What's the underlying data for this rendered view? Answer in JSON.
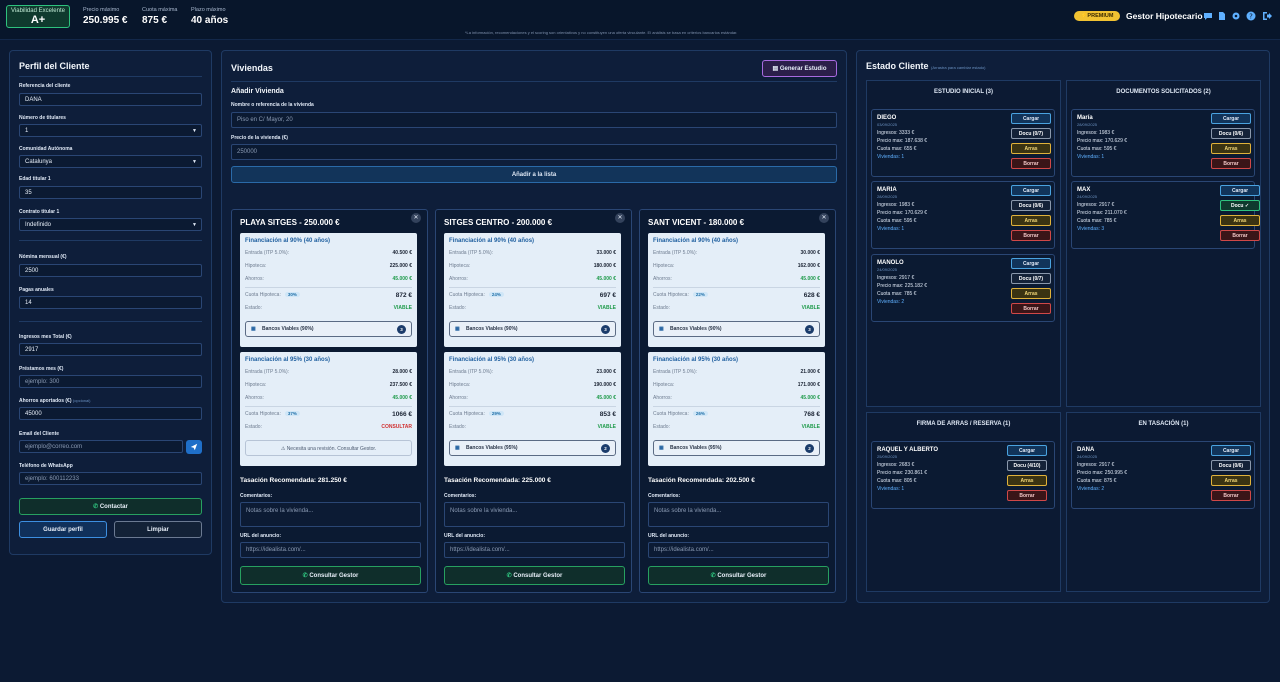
{
  "topbar": {
    "viability_title": "Viabilidad Excelente",
    "viability_grade": "A+",
    "stats": [
      {
        "label": "Precio máximo",
        "value": "250.995 €"
      },
      {
        "label": "Cuota máxima",
        "value": "875 €"
      },
      {
        "label": "Plazo máximo",
        "value": "40 años"
      }
    ],
    "premium": "⚡PREMIUM",
    "title": "Gestor Hipotecario",
    "icons": [
      "chat-icon",
      "document-icon",
      "gear-icon",
      "help-icon",
      "logout-icon"
    ],
    "disclaimer": "*La información, recomendaciones y el scoring son orientativos y no constituyen una oferta vinculante. El análisis se basa en criterios bancarios estándar."
  },
  "perfil": {
    "title": "Perfil del Cliente",
    "ref_label": "Referencia del cliente",
    "ref_value": "DANA",
    "titulares_label": "Número de titulares",
    "titulares_value": "1",
    "comunidad_label": "Comunidad Autónoma",
    "comunidad_value": "Catalunya",
    "edad_label": "Edad titular 1",
    "edad_value": "35",
    "contrato_label": "Contrato titular 1",
    "contrato_value": "Indefinido",
    "nomina_label": "Nómina mensual (€)",
    "nomina_value": "2500",
    "pagas_label": "Pagas anuales",
    "pagas_value": "14",
    "ingresos_label": "Ingresos mes Total (€)",
    "ingresos_value": "2917",
    "prestamos_label": "Préstamos mes (€)",
    "prestamos_placeholder": "ejemplo: 300",
    "ahorros_label": "Ahorros aportados (€)",
    "ahorros_opt": "(opcional)",
    "ahorros_value": "45000",
    "email_label": "Email del Cliente",
    "email_placeholder": "ejemplo@correo.com",
    "whatsapp_label": "Teléfono de WhatsApp",
    "whatsapp_placeholder": "ejemplo: 600112233",
    "contactar": "Contactar",
    "guardar": "Guardar perfil",
    "limpiar": "Limpiar"
  },
  "viviendas": {
    "title": "Viviendas",
    "generar": "Generar Estudio",
    "add_title": "Añadir Vivienda",
    "name_label": "Nombre o referencia de la vivienda",
    "name_placeholder": "Piso en C/ Mayor, 20",
    "price_label": "Precio de la vivienda (€)",
    "price_placeholder": "250000",
    "add_button": "Añadir a la lista",
    "cards": [
      {
        "title": "PLAYA SITGES - 250.000 €",
        "f1": {
          "h": "Financiación al 90% (40 años)",
          "itp": "Entrada (ITP 5.0%):",
          "itpv": "40.500 €",
          "hip": "Hipoteca:",
          "hipv": "225.000 €",
          "aho": "Ahorros:",
          "ahov": "45.000 €",
          "cuota": "Cuota Hipoteca:",
          "pct": "30%",
          "cuotav": "872 €",
          "est": "Estado:",
          "estv": "VIABLE",
          "bank": "Bancos Viables (90%)",
          "n": "3"
        },
        "f2": {
          "h": "Financiación al 95% (30 años)",
          "itp": "Entrada (ITP 5.0%):",
          "itpv": "28.000 €",
          "hip": "Hipoteca:",
          "hipv": "237.500 €",
          "aho": "Ahorros:",
          "ahov": "45.000 €",
          "cuota": "Cuota Hipoteca:",
          "pct": "37%",
          "cuotav": "1066 €",
          "est": "Estado:",
          "estv": "CONSULTAR",
          "revision": "Necesita una revisión. Consultar Gestor."
        },
        "tas_label": "Tasación Recomendada:",
        "tas_value": "281.250 €",
        "com_label": "Comentarios:",
        "com_ph": "Notas sobre la vivienda...",
        "url_label": "URL del anuncio:",
        "url_ph": "https://idealista.com/...",
        "consult": "Consultar Gestor"
      },
      {
        "title": "SITGES CENTRO - 200.000 €",
        "f1": {
          "h": "Financiación al 90% (40 años)",
          "itp": "Entrada (ITP 5.0%):",
          "itpv": "33.000 €",
          "hip": "Hipoteca:",
          "hipv": "180.000 €",
          "aho": "Ahorros:",
          "ahov": "45.000 €",
          "cuota": "Cuota Hipoteca:",
          "pct": "24%",
          "cuotav": "697 €",
          "est": "Estado:",
          "estv": "VIABLE",
          "bank": "Bancos Viables (90%)",
          "n": "3"
        },
        "f2": {
          "h": "Financiación al 95% (30 años)",
          "itp": "Entrada (ITP 5.0%):",
          "itpv": "23.000 €",
          "hip": "Hipoteca:",
          "hipv": "190.000 €",
          "aho": "Ahorros:",
          "ahov": "45.000 €",
          "cuota": "Cuota Hipoteca:",
          "pct": "29%",
          "cuotav": "853 €",
          "est": "Estado:",
          "estv": "VIABLE",
          "bank": "Bancos Viables (95%)",
          "n": "2"
        },
        "tas_label": "Tasación Recomendada:",
        "tas_value": "225.000 €",
        "com_label": "Comentarios:",
        "com_ph": "Notas sobre la vivienda...",
        "url_label": "URL del anuncio:",
        "url_ph": "https://idealista.com/...",
        "consult": "Consultar Gestor"
      },
      {
        "title": "SANT VICENT - 180.000 €",
        "f1": {
          "h": "Financiación al 90% (40 años)",
          "itp": "Entrada (ITP 5.0%):",
          "itpv": "30.000 €",
          "hip": "Hipoteca:",
          "hipv": "162.000 €",
          "aho": "Ahorros:",
          "ahov": "45.000 €",
          "cuota": "Cuota Hipoteca:",
          "pct": "22%",
          "cuotav": "628 €",
          "est": "Estado:",
          "estv": "VIABLE",
          "bank": "Bancos Viables (90%)",
          "n": "3"
        },
        "f2": {
          "h": "Financiación al 95% (30 años)",
          "itp": "Entrada (ITP 5.0%):",
          "itpv": "21.000 €",
          "hip": "Hipoteca:",
          "hipv": "171.000 €",
          "aho": "Ahorros:",
          "ahov": "45.000 €",
          "cuota": "Cuota Hipoteca:",
          "pct": "26%",
          "cuotav": "768 €",
          "est": "Estado:",
          "estv": "VIABLE",
          "bank": "Bancos Viables (95%)",
          "n": "2"
        },
        "tas_label": "Tasación Recomendada:",
        "tas_value": "202.500 €",
        "com_label": "Comentarios:",
        "com_ph": "Notas sobre la vivienda...",
        "url_label": "URL del anuncio:",
        "url_ph": "https://idealista.com/...",
        "consult": "Consultar Gestor"
      }
    ]
  },
  "estado": {
    "title": "Estado Cliente",
    "subtitle": "(Arrastra para cambiar estado)",
    "buttons": {
      "cargar": "Cargar",
      "arras": "Arras",
      "borrar": "Borrar"
    },
    "columns": [
      {
        "title": "ESTUDIO INICIAL (3)",
        "clients": [
          {
            "name": "DIEGO",
            "date": "03/09/2025",
            "ing": "Ingresos: 3333 €",
            "pre": "Precio max: 187.638 €",
            "cuo": "Cuota max: 655 €",
            "viv": "Viviendas: 1",
            "docu": "Docu (0/7)"
          },
          {
            "name": "MARIA",
            "date": "28/09/2025",
            "ing": "Ingresos: 1983 €",
            "pre": "Precio max: 170.629 €",
            "cuo": "Cuota max: 595 €",
            "viv": "Viviendas: 1",
            "docu": "Docu (0/6)"
          },
          {
            "name": "MANOLO",
            "date": "24/09/2025",
            "ing": "Ingresos: 2917 €",
            "pre": "Precio max: 225.182 €",
            "cuo": "Cuota max: 785 €",
            "viv": "Viviendas: 2",
            "docu": "Docu (0/7)"
          }
        ]
      },
      {
        "title": "DOCUMENTOS SOLICITADOS (2)",
        "clients": [
          {
            "name": "María",
            "date": "28/09/2025",
            "ing": "Ingresos: 1983 €",
            "pre": "Precio max: 170.629 €",
            "cuo": "Cuota max: 595 €",
            "viv": "Viviendas: 1",
            "docu": "Docu (0/6)"
          },
          {
            "name": "MAX",
            "date": "24/09/2025",
            "ing": "Ingresos: 2917 €",
            "pre": "Precio max: 211.070 €",
            "cuo": "Cuota max: 785 €",
            "viv": "Viviendas: 3",
            "docu": "Docu ✓"
          }
        ]
      },
      {
        "title": "FIRMA DE ARRAS / RESERVA (1)",
        "clients": [
          {
            "name": "RAQUEL Y ALBERTO",
            "date": "25/09/2025",
            "ing": "Ingresos: 2683 €",
            "pre": "Precio max: 230.861 €",
            "cuo": "Cuota max: 805 €",
            "viv": "Viviendas: 1",
            "docu": "Docu (4/10)"
          }
        ]
      },
      {
        "title": "EN TASACIÓN (1)",
        "clients": [
          {
            "name": "DANA",
            "date": "24/09/2025",
            "ing": "Ingresos: 2917 €",
            "pre": "Precio max: 250.995 €",
            "cuo": "Cuota max: 875 €",
            "viv": "Viviendas: 2",
            "docu": "Docu (0/6)"
          }
        ]
      }
    ]
  },
  "colors": {
    "accent": "#5fb0ff",
    "viable": "#1e9a4a",
    "consult": "#d03030",
    "premium": "#f1c232",
    "background": "#0c1a33"
  }
}
